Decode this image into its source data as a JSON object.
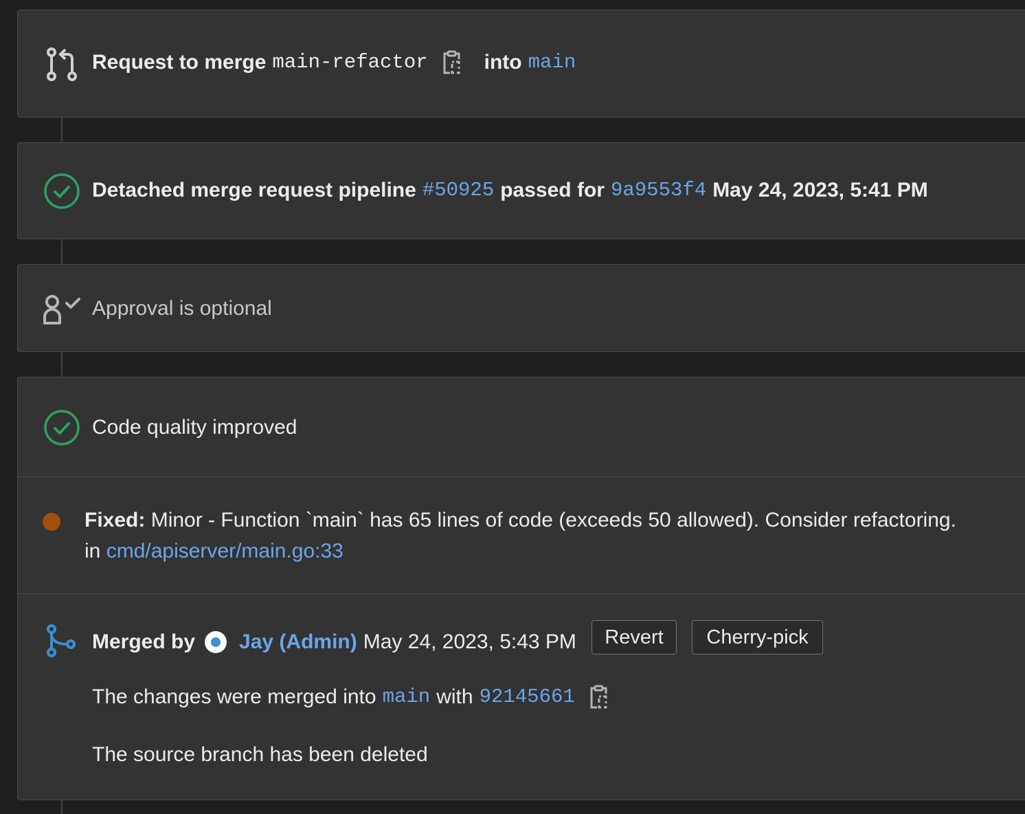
{
  "merge_request": {
    "prefix": "Request to merge",
    "source_branch": "main-refactor",
    "into_label": "into",
    "target_branch": "main",
    "icon": "merge-request-icon",
    "copy_icon": "copy-to-clipboard-icon"
  },
  "pipeline": {
    "label": "Detached merge request pipeline",
    "id": "#50925",
    "passed_for": "passed for",
    "commit": "9a9553f4",
    "timestamp": "May 24, 2023, 5:41 PM",
    "status_color": "#2da160",
    "icon": "status-success-icon"
  },
  "approval": {
    "text": "Approval is optional",
    "icon": "approval-icon"
  },
  "code_quality": {
    "title": "Code quality improved",
    "icon": "status-success-icon",
    "finding": {
      "label": "Fixed:",
      "text": "Minor - Function `main` has 65 lines of code (exceeds 50 allowed). Consider refactoring.",
      "in_label": "in",
      "location": "cmd/apiserver/main.go:33",
      "severity_color": "#a14f0a"
    }
  },
  "merged": {
    "label": "Merged by",
    "user": "Jay (Admin)",
    "timestamp": "May 24, 2023, 5:43 PM",
    "revert_label": "Revert",
    "cherry_pick_label": "Cherry-pick",
    "changes_prefix": "The changes were merged into",
    "branch": "main",
    "with_label": "with",
    "commit": "92145661",
    "deleted_text": "The source branch has been deleted",
    "icon": "merged-icon"
  },
  "colors": {
    "background": "#1f1f1f",
    "card": "#333333",
    "link": "#6ba5ea",
    "success": "#2da160"
  }
}
